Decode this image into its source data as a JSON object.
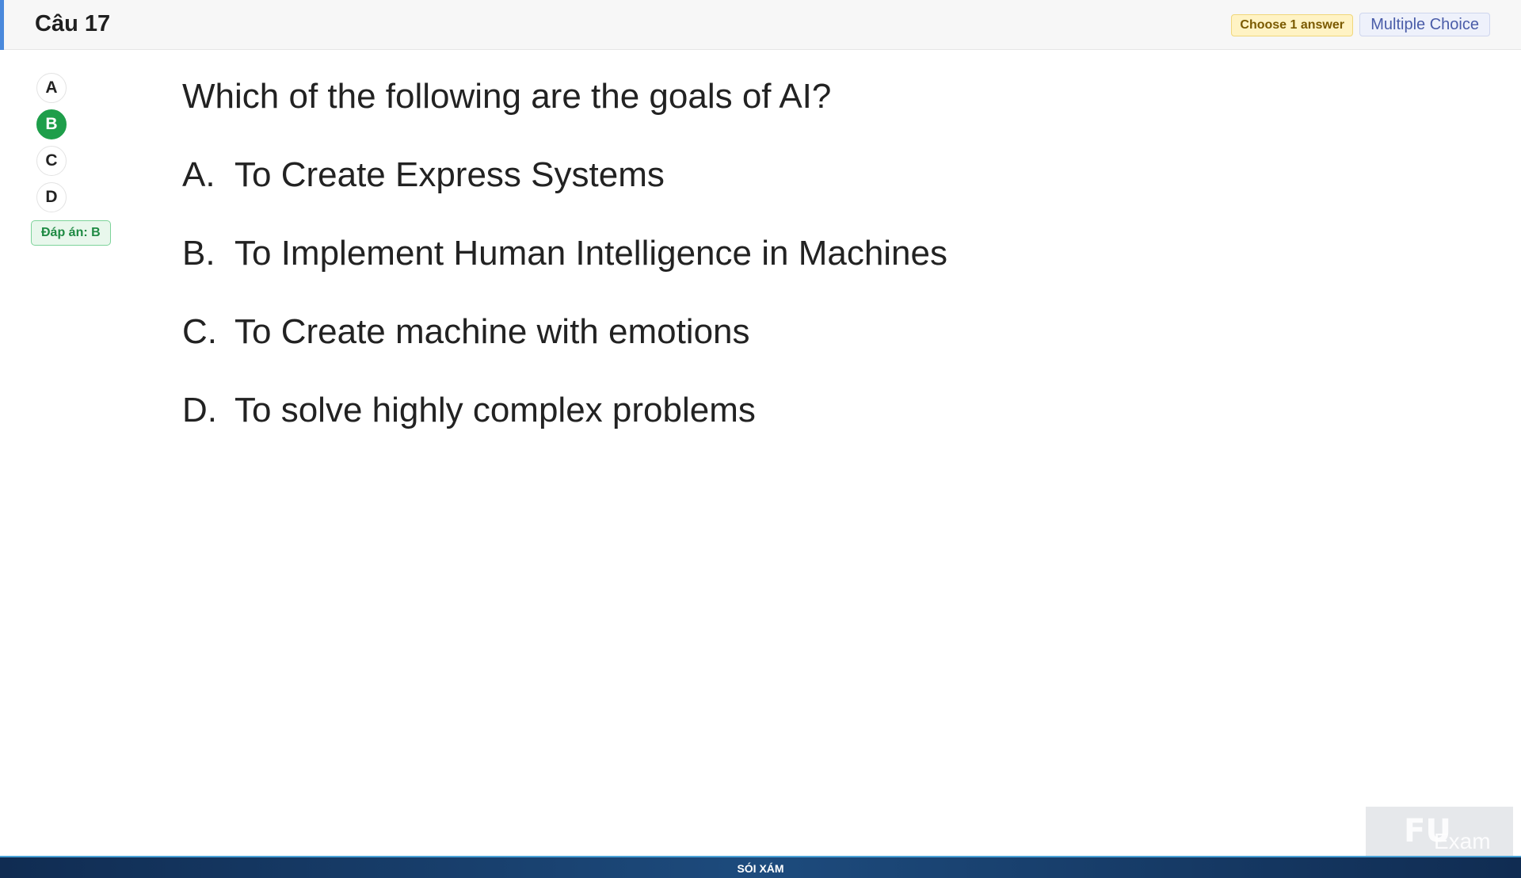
{
  "header": {
    "title": "Câu 17",
    "badge_choose": "Choose 1 answer",
    "badge_type": "Multiple Choice"
  },
  "choices": [
    {
      "label": "A",
      "selected": false
    },
    {
      "label": "B",
      "selected": true
    },
    {
      "label": "C",
      "selected": false
    },
    {
      "label": "D",
      "selected": false
    }
  ],
  "answer_tag": "Đáp án: B",
  "question": {
    "text": "Which of the following are the goals of AI?",
    "options": [
      {
        "letter": "A.",
        "text": "To Create Express Systems"
      },
      {
        "letter": "B.",
        "text": "To Implement Human Intelligence in Machines"
      },
      {
        "letter": "C.",
        "text": "To Create machine with emotions"
      },
      {
        "letter": "D.",
        "text": "To solve highly complex problems"
      }
    ]
  },
  "footer": {
    "text": "SÓI XÁM"
  },
  "watermark": {
    "logo": "FU",
    "text": "Exam"
  },
  "colors": {
    "selected": "#1e9e4a",
    "accent": "#4a89dc"
  }
}
